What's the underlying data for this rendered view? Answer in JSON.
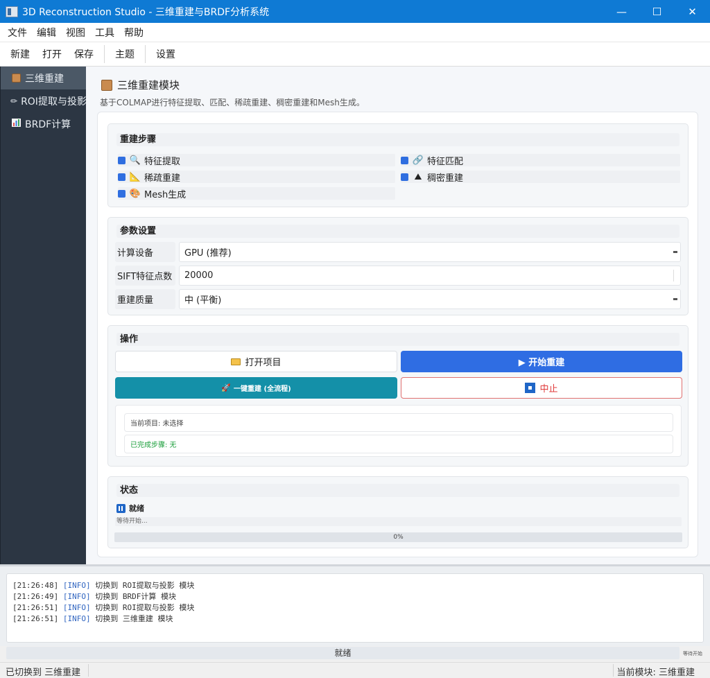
{
  "window": {
    "title": "3D Reconstruction Studio - 三维重建与BRDF分析系统",
    "minimize": "—",
    "maximize": "☐",
    "close": "✕"
  },
  "menubar": [
    "文件",
    "编辑",
    "视图",
    "工具",
    "帮助"
  ],
  "toolbar": {
    "group1": [
      "新建",
      "打开",
      "保存"
    ],
    "theme": "主题",
    "settings": "设置"
  },
  "sidebar": {
    "items": [
      {
        "label": "三维重建",
        "icon": "cube-icon",
        "active": true
      },
      {
        "label": "ROI提取与投影",
        "icon": "pencil-icon",
        "active": false
      },
      {
        "label": "BRDF计算",
        "icon": "bar-chart-icon",
        "active": false
      }
    ]
  },
  "page": {
    "title": "三维重建模块",
    "description": "基于COLMAP进行特征提取、匹配、稀疏重建、稠密重建和Mesh生成。"
  },
  "steps": {
    "title": "重建步骤",
    "items": [
      {
        "label": "特征提取",
        "icon": "magnifier-icon",
        "glyph": "🔍",
        "checked": true
      },
      {
        "label": "特征匹配",
        "icon": "link-icon",
        "glyph": "🔗",
        "checked": true
      },
      {
        "label": "稀疏重建",
        "icon": "triangle-ruler-icon",
        "glyph": "📐",
        "checked": true
      },
      {
        "label": "稠密重建",
        "icon": "mountain-icon",
        "glyph": "⛰",
        "checked": true
      },
      {
        "label": "Mesh生成",
        "icon": "palette-icon",
        "glyph": "🎨",
        "checked": true
      }
    ]
  },
  "params": {
    "title": "参数设置",
    "rows": [
      {
        "label": "计算设备",
        "value": "GPU (推荐)",
        "kind": "select"
      },
      {
        "label": "SIFT特征点数",
        "value": "20000",
        "kind": "spin"
      },
      {
        "label": "重建质量",
        "value": "中 (平衡)",
        "kind": "select"
      }
    ]
  },
  "actions": {
    "title": "操作",
    "open_project": "打开项目",
    "start": "▶ 开始重建",
    "one_click": "一键重建 (全流程)",
    "stop": "中止",
    "current_project": "当前项目: 未选择",
    "completed_steps": "已完成步骤: 无",
    "completed_color": "#1a9e3a"
  },
  "status": {
    "title": "状态",
    "state": "就绪",
    "message": "等待开始...",
    "progress_text": "0%",
    "progress": 0
  },
  "log": [
    {
      "time": "[21:26:48]",
      "level": "[INFO]",
      "msg": "切换到 ROI提取与投影 模块"
    },
    {
      "time": "[21:26:49]",
      "level": "[INFO]",
      "msg": "切换到 BRDF计算 模块"
    },
    {
      "time": "[21:26:51]",
      "level": "[INFO]",
      "msg": "切换到 ROI提取与投影 模块"
    },
    {
      "time": "[21:26:51]",
      "level": "[INFO]",
      "msg": "切换到 三维重建 模块"
    }
  ],
  "bottom": {
    "progress_label": "就绪",
    "note": "等待开始"
  },
  "statusbar": {
    "left": "已切换到 三维重建",
    "right": "当前模块: 三维重建"
  },
  "colors": {
    "titlebar": "#0f7ad4",
    "sidebar": "#2c3643",
    "primary": "#2f6de3",
    "teal": "#1490a8",
    "danger": "#e03b3b"
  }
}
